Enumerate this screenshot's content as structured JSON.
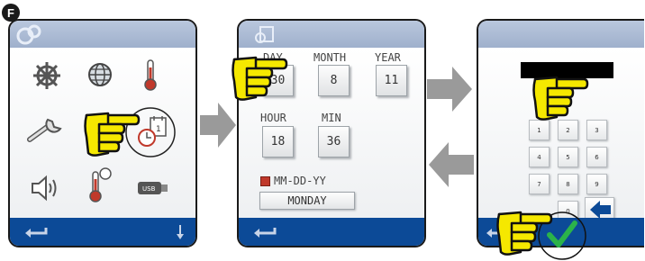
{
  "step": {
    "label": "F"
  },
  "screen1": {
    "icons": [
      "helm-icon",
      "globe-icon",
      "thermometer-icon",
      "wrench-icon",
      "clock-calendar-icon",
      "speaker-icon",
      "thermometer-sun-icon",
      "usb-icon"
    ]
  },
  "screen2": {
    "fields": {
      "day": {
        "label": "DAY",
        "value": "30"
      },
      "month": {
        "label": "MONTH",
        "value": "8"
      },
      "year": {
        "label": "YEAR",
        "value": "11"
      },
      "hour": {
        "label": "HOUR",
        "value": "18"
      },
      "min": {
        "label": "MIN",
        "value": "36"
      }
    },
    "format_label": "MM-DD-YY",
    "weekday": "MONDAY"
  },
  "screen3": {
    "keys": [
      "1",
      "2",
      "3",
      "4",
      "5",
      "6",
      "7",
      "8",
      "9",
      "0"
    ]
  },
  "colors": {
    "bottom_bar": "#0c4a97",
    "top_bar": "#a9b8d2",
    "check": "#2bb34a",
    "hand": "#f5e800"
  }
}
